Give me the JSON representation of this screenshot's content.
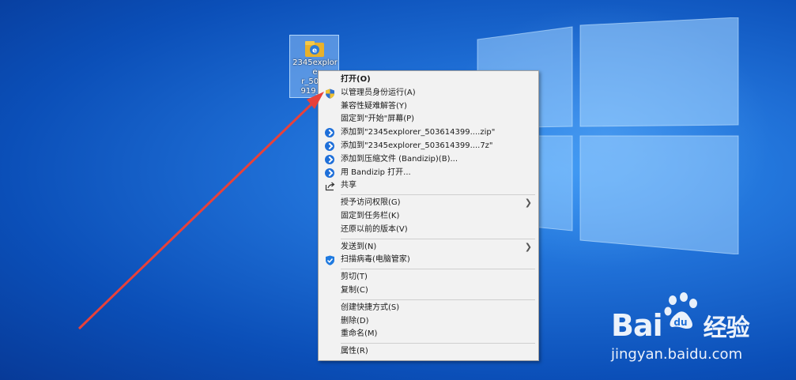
{
  "desktop": {
    "icon_label": "2345explorer_503614399_V_...e",
    "icon_label_lines": [
      "2345explore",
      "r_5036",
      "919_V_",
      "e"
    ]
  },
  "context_menu": {
    "groups": [
      [
        {
          "label": "打开(O)",
          "bold": true,
          "icon": ""
        },
        {
          "label": "以管理员身份运行(A)",
          "icon": "uac-shield-icon"
        },
        {
          "label": "兼容性疑难解答(Y)",
          "icon": ""
        },
        {
          "label": "固定到\"开始\"屏幕(P)",
          "icon": ""
        },
        {
          "label": "添加到\"2345explorer_503614399....zip\"",
          "icon": "bandizip-icon"
        },
        {
          "label": "添加到\"2345explorer_503614399....7z\"",
          "icon": "bandizip-icon"
        },
        {
          "label": "添加到压缩文件 (Bandizip)(B)...",
          "icon": "bandizip-icon"
        },
        {
          "label": "用 Bandizip 打开...",
          "icon": "bandizip-icon"
        },
        {
          "label": "共享",
          "icon": "share-icon"
        }
      ],
      [
        {
          "label": "授予访问权限(G)",
          "submenu": true
        },
        {
          "label": "固定到任务栏(K)"
        },
        {
          "label": "还原以前的版本(V)"
        }
      ],
      [
        {
          "label": "发送到(N)",
          "submenu": true
        },
        {
          "label": "扫描病毒(电脑管家)",
          "icon": "pc-manager-shield-icon"
        }
      ],
      [
        {
          "label": "剪切(T)"
        },
        {
          "label": "复制(C)"
        }
      ],
      [
        {
          "label": "创建快捷方式(S)"
        },
        {
          "label": "删除(D)"
        },
        {
          "label": "重命名(M)"
        }
      ],
      [
        {
          "label": "属性(R)"
        }
      ]
    ]
  },
  "watermark": {
    "brand_left": "Bai",
    "brand_right": "经验",
    "url": "jingyan.baidu.com"
  },
  "colors": {
    "desktop_bg": "#1f6fd6",
    "menu_bg": "#f2f2f2",
    "arrow": "#e8413a",
    "bandizip_blue": "#1e6fd9"
  }
}
